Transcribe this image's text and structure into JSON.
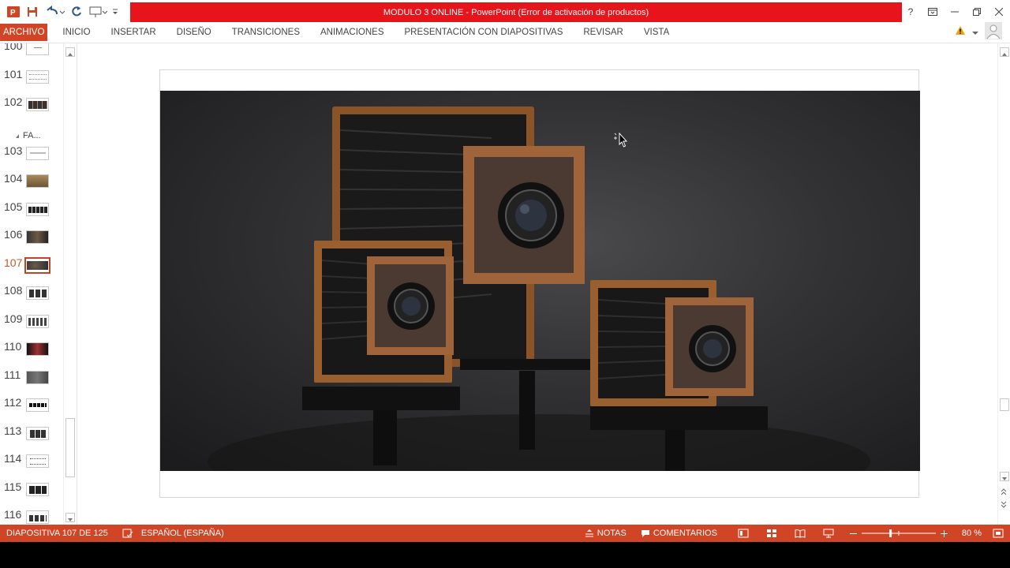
{
  "window": {
    "title": "MODULO 3 ONLINE - PowerPoint (Error de activación de productos)",
    "help_label": "?",
    "accent_color": "#e8141c"
  },
  "quick_access": {
    "icons": [
      "powerpoint-logo-icon",
      "save-icon",
      "undo-icon",
      "redo-icon",
      "present-from-start-icon",
      "customize-qat-icon"
    ]
  },
  "ribbon": {
    "tabs": [
      {
        "label": "ARCHIVO"
      },
      {
        "label": "INICIO"
      },
      {
        "label": "INSERTAR"
      },
      {
        "label": "DISEÑO"
      },
      {
        "label": "TRANSICIONES"
      },
      {
        "label": "ANIMACIONES"
      },
      {
        "label": "PRESENTACIÓN CON DIAPOSITIVAS"
      },
      {
        "label": "REVISAR"
      },
      {
        "label": "VISTA"
      }
    ],
    "file_tab_color": "#d04525"
  },
  "slides_panel": {
    "section_label": "FA...",
    "thumbnails": [
      {
        "number": "100"
      },
      {
        "number": "101"
      },
      {
        "number": "102"
      },
      {
        "number": "103"
      },
      {
        "number": "104"
      },
      {
        "number": "105"
      },
      {
        "number": "106"
      },
      {
        "number": "107",
        "active": true
      },
      {
        "number": "108"
      },
      {
        "number": "109"
      },
      {
        "number": "110"
      },
      {
        "number": "111"
      },
      {
        "number": "112"
      },
      {
        "number": "113"
      },
      {
        "number": "114"
      },
      {
        "number": "115"
      },
      {
        "number": "116"
      }
    ]
  },
  "slide": {
    "image_subject": "Three large-format wooden field cameras with bellows on tripods against a dark studio background"
  },
  "statusbar": {
    "slide_counter": "DIAPOSITIVA 107 DE 125",
    "language": "ESPAÑOL (ESPAÑA)",
    "notes_label": "NOTAS",
    "comments_label": "COMENTARIOS",
    "zoom_label": "80 %",
    "zoom_value": 80,
    "bar_color": "#d04525"
  }
}
